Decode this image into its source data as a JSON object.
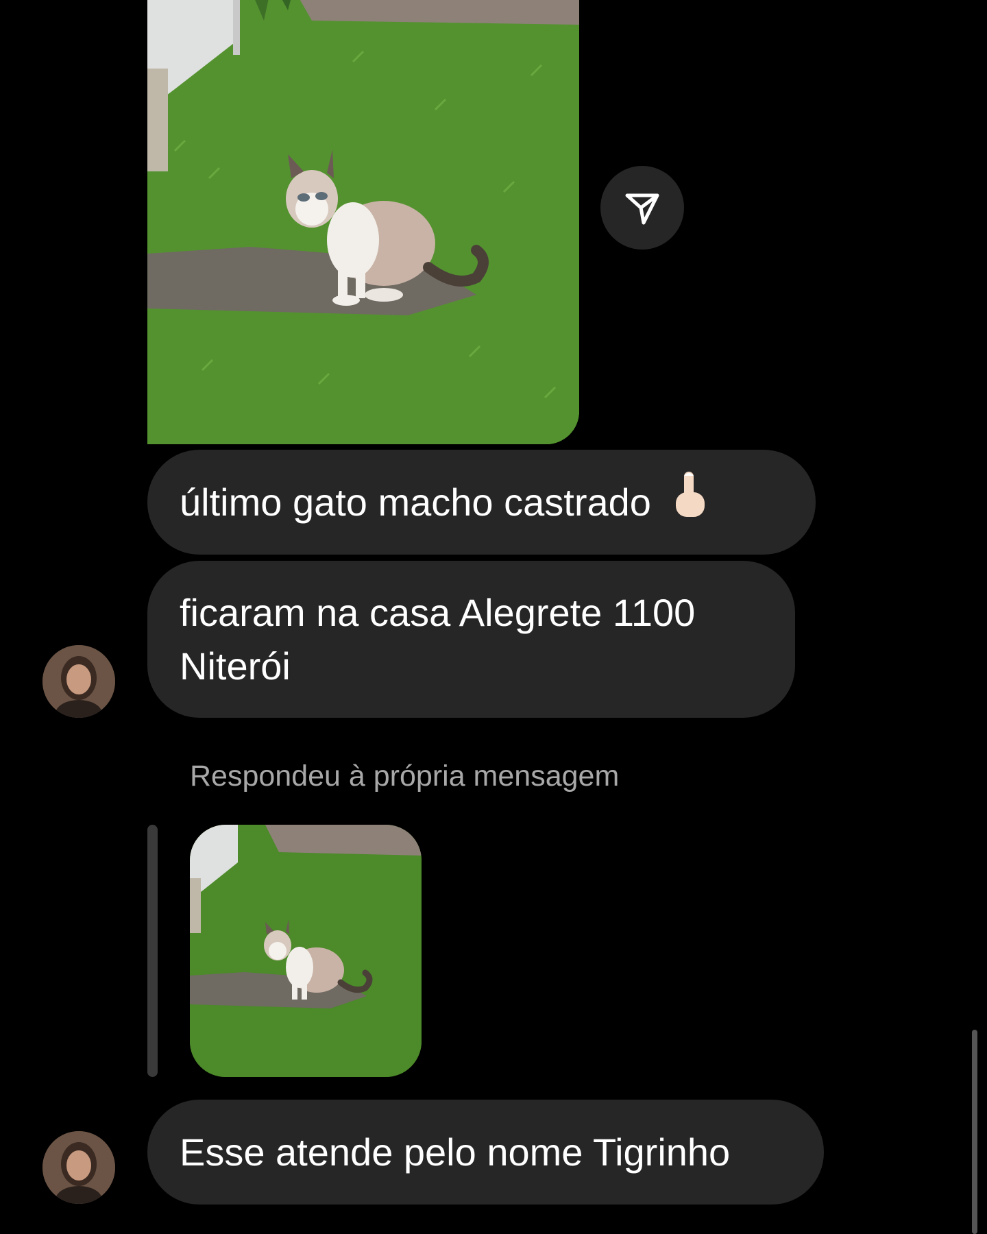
{
  "messages": {
    "m1": "último gato macho castrado",
    "m2": "ficaram na casa Alegrete 1100\nNiterói",
    "m3": "Esse atende pelo nome Tigrinho"
  },
  "reply_label": "Respondeu à própria mensagem",
  "icons": {
    "share": "paper-plane-icon",
    "emoji": "backhand-index-pointing-up-icon"
  },
  "colors": {
    "background": "#000000",
    "bubble": "#262626",
    "muted_text": "#a8a8a8"
  }
}
